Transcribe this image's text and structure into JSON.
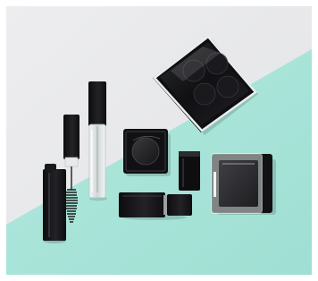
{
  "scene": {
    "subject": "cosmetic-packaging-flatlay",
    "colors": {
      "background_top": "#e9e9eb",
      "background_bottom": "#a7e3d8",
      "product_black": "#141416",
      "clear_plastic": "#dfe6e6",
      "highlight": "#ffffff"
    },
    "items": [
      {
        "name": "mascara-tube"
      },
      {
        "name": "mascara-wand"
      },
      {
        "name": "lip-gloss-tube"
      },
      {
        "name": "eyeshadow-palette-large"
      },
      {
        "name": "compact-small"
      },
      {
        "name": "compact-cube"
      },
      {
        "name": "compact-clear-lid"
      },
      {
        "name": "lipstick-case"
      }
    ]
  }
}
